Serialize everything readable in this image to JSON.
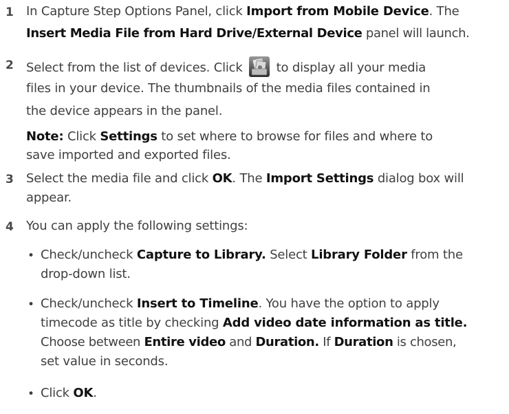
{
  "steps": [
    {
      "number": "1",
      "line1": {
        "a": "In Capture Step Options Panel, click ",
        "b": "Import from Mobile Device",
        "c": ". The"
      },
      "line2": {
        "a": "Insert Media File from Hard Drive/External Device",
        "b": " panel will launch."
      }
    },
    {
      "number": "2",
      "line1": {
        "a": "Select from the list of devices. Click ",
        "b": " to display all your media"
      },
      "line2": "files in your device. The thumbnails of the media files contained in",
      "line3": "the device appears in the panel.",
      "note": {
        "label": "Note:",
        "a": "  Click ",
        "b": "Settings",
        "c": " to set where to browse for files and where to",
        "line2": "save imported and exported files."
      },
      "icon": "folder-media-icon"
    },
    {
      "number": "3",
      "line1": {
        "a": "Select the media file and click ",
        "b": "OK",
        "c": ". The ",
        "d": "Import Settings",
        "e": " dialog box will"
      },
      "line2": "appear."
    },
    {
      "number": "4",
      "line1": "You can apply the following settings:",
      "bullets": [
        {
          "marker": "•",
          "l1": {
            "a": "Check/uncheck ",
            "b": "Capture to Library.",
            "c": " Select ",
            "d": "Library Folder",
            "e": " from the"
          },
          "l2": "drop-down list."
        },
        {
          "marker": "•",
          "l1": {
            "a": "Check/uncheck ",
            "b": "Insert to Timeline",
            "c": ". You have the option to apply"
          },
          "l2": {
            "a": "timecode as title by checking ",
            "b": "Add video date information as title."
          },
          "l3": {
            "a": "Choose between ",
            "b": "Entire video",
            "c": " and ",
            "d": "Duration.",
            "e": " If ",
            "f": "Duration",
            "g": " is chosen,"
          },
          "l4": "set value in seconds."
        },
        {
          "marker": "•",
          "l1": {
            "a": "Click ",
            "b": "OK",
            "c": "."
          }
        }
      ]
    }
  ],
  "colors": {
    "text": "#3f3f3f",
    "bold": "#111111"
  }
}
